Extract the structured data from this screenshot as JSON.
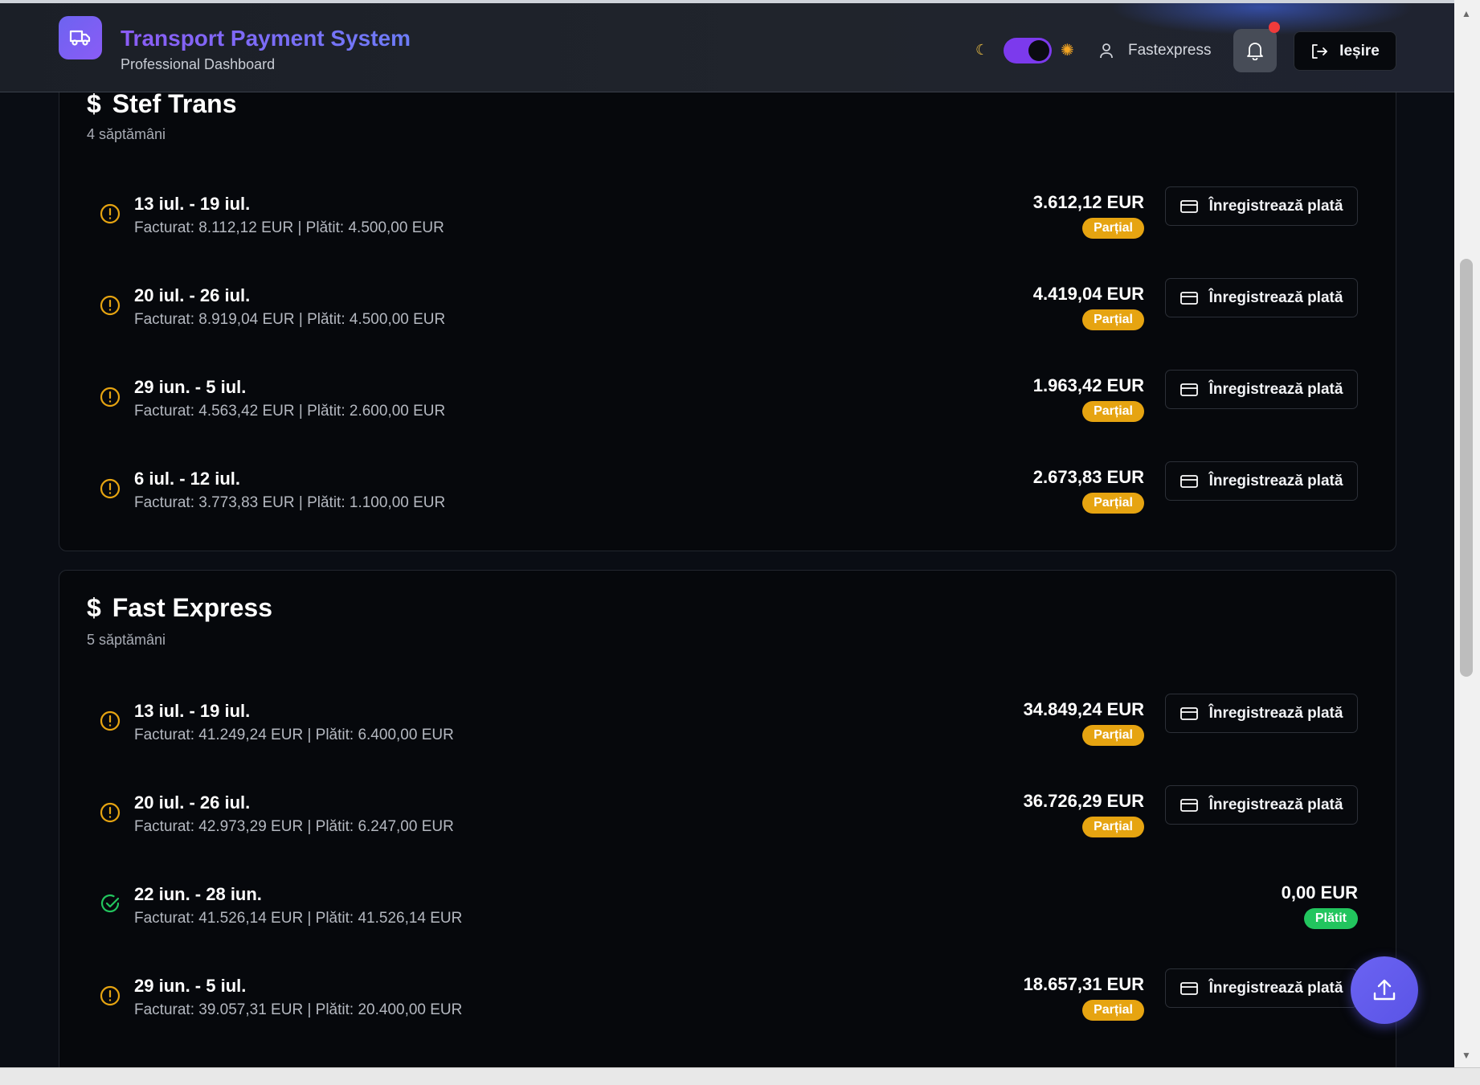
{
  "header": {
    "title": "Transport Payment System",
    "subtitle": "Professional Dashboard",
    "user_name": "Fastexpress",
    "logout_label": "Ieșire",
    "theme_toggle": {
      "moon_icon": "moon-icon",
      "sun_icon": "sun-icon",
      "state": "dark"
    },
    "notification_dot_color": "#ef3b3b"
  },
  "colors": {
    "accent": "#7c3aed",
    "partial": "#e6a411",
    "paid": "#22c55e"
  },
  "cards": [
    {
      "currency_icon": "$",
      "name": "Stef Trans",
      "weeks": "4 săptămâni",
      "rows": [
        {
          "period": "13 iul. - 19 iul.",
          "details": "Facturat: 8.112,12 EUR | Plătit: 4.500,00 EUR",
          "amount": "3.612,12 EUR",
          "status": "Parțial",
          "status_icon": "alert-circle-icon",
          "action": "Înregistrează plată"
        },
        {
          "period": "20 iul. - 26 iul.",
          "details": "Facturat: 8.919,04 EUR | Plătit: 4.500,00 EUR",
          "amount": "4.419,04 EUR",
          "status": "Parțial",
          "status_icon": "alert-circle-icon",
          "action": "Înregistrează plată"
        },
        {
          "period": "29 iun. - 5 iul.",
          "details": "Facturat: 4.563,42 EUR | Plătit: 2.600,00 EUR",
          "amount": "1.963,42 EUR",
          "status": "Parțial",
          "status_icon": "alert-circle-icon",
          "action": "Înregistrează plată"
        },
        {
          "period": "6 iul. - 12 iul.",
          "details": "Facturat: 3.773,83 EUR | Plătit: 1.100,00 EUR",
          "amount": "2.673,83 EUR",
          "status": "Parțial",
          "status_icon": "alert-circle-icon",
          "action": "Înregistrează plată"
        }
      ]
    },
    {
      "currency_icon": "$",
      "name": "Fast Express",
      "weeks": "5 săptămâni",
      "rows": [
        {
          "period": "13 iul. - 19 iul.",
          "details": "Facturat: 41.249,24 EUR | Plătit: 6.400,00 EUR",
          "amount": "34.849,24 EUR",
          "status": "Parțial",
          "status_icon": "alert-circle-icon",
          "action": "Înregistrează plată"
        },
        {
          "period": "20 iul. - 26 iul.",
          "details": "Facturat: 42.973,29 EUR | Plătit: 6.247,00 EUR",
          "amount": "36.726,29 EUR",
          "status": "Parțial",
          "status_icon": "alert-circle-icon",
          "action": "Înregistrează plată"
        },
        {
          "period": "22 iun. - 28 iun.",
          "details": "Facturat: 41.526,14 EUR | Plătit: 41.526,14 EUR",
          "amount": "0,00 EUR",
          "status": "Plătit",
          "status_icon": "check-circle-icon",
          "action": ""
        },
        {
          "period": "29 iun. - 5 iul.",
          "details": "Facturat: 39.057,31 EUR | Plătit: 20.400,00 EUR",
          "amount": "18.657,31 EUR",
          "status": "Parțial",
          "status_icon": "alert-circle-icon",
          "action": "Înregistrează plată"
        }
      ]
    }
  ],
  "fab": {
    "icon": "upload-icon"
  }
}
